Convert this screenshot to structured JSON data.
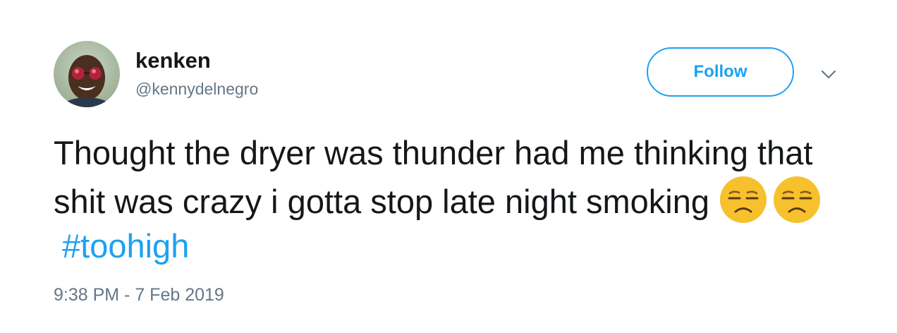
{
  "user": {
    "display_name": "kenken",
    "handle": "@kennydelnegro"
  },
  "follow_button": {
    "label": "Follow"
  },
  "tweet": {
    "text_main": "Thought the dryer was thunder had me thinking that shit was crazy i gotta stop late night smoking",
    "emojis": [
      "unamused-face",
      "unamused-face"
    ],
    "hashtag": "#toohigh",
    "timestamp": "9:38 PM - 7 Feb 2019"
  },
  "colors": {
    "accent": "#1da1f2",
    "text": "#14171a",
    "muted": "#657786"
  },
  "icons": {
    "avatar": "profile-photo",
    "menu": "chevron-down-icon",
    "emoji": "unamused-face"
  }
}
